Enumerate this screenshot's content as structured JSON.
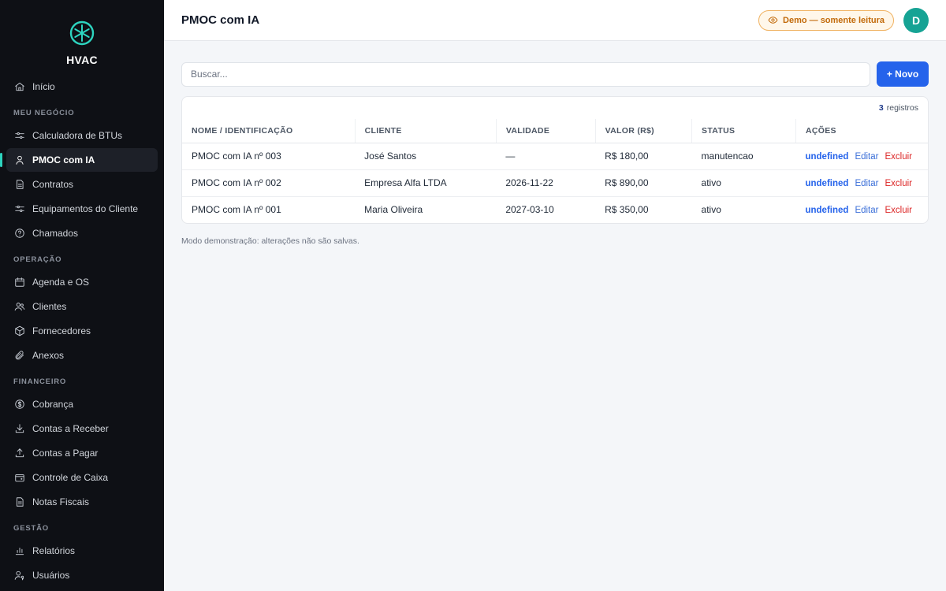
{
  "brand": {
    "name": "HVAC",
    "accent": "#2dd4bf"
  },
  "sidebar": {
    "top_items": [
      {
        "label": "Início",
        "icon": "home-icon"
      }
    ],
    "sections": [
      {
        "title": "MEU NEGÓCIO",
        "items": [
          {
            "label": "Calculadora de BTUs",
            "icon": "sliders-icon"
          },
          {
            "label": "PMOC com IA",
            "icon": "user-shield-icon",
            "active": true
          },
          {
            "label": "Contratos",
            "icon": "document-icon"
          },
          {
            "label": "Equipamentos do Cliente",
            "icon": "sliders-icon"
          },
          {
            "label": "Chamados",
            "icon": "help-circle-icon"
          }
        ]
      },
      {
        "title": "OPERAÇÃO",
        "items": [
          {
            "label": "Agenda e OS",
            "icon": "calendar-icon"
          },
          {
            "label": "Clientes",
            "icon": "users-icon"
          },
          {
            "label": "Fornecedores",
            "icon": "box-icon"
          },
          {
            "label": "Anexos",
            "icon": "paperclip-icon"
          }
        ]
      },
      {
        "title": "FINANCEIRO",
        "items": [
          {
            "label": "Cobrança",
            "icon": "dollar-circle-icon"
          },
          {
            "label": "Contas a Receber",
            "icon": "download-icon"
          },
          {
            "label": "Contas a Pagar",
            "icon": "upload-icon"
          },
          {
            "label": "Controle de Caixa",
            "icon": "wallet-icon"
          },
          {
            "label": "Notas Fiscais",
            "icon": "document-icon"
          }
        ]
      },
      {
        "title": "GESTÃO",
        "items": [
          {
            "label": "Relatórios",
            "icon": "bar-chart-icon"
          },
          {
            "label": "Usuários",
            "icon": "user-key-icon"
          }
        ]
      }
    ]
  },
  "header": {
    "title": "PMOC com IA",
    "demo_badge": "Demo — somente leitura",
    "avatar_initial": "D"
  },
  "toolbar": {
    "search_placeholder": "Buscar...",
    "new_label": "+ Novo"
  },
  "table": {
    "count": "3",
    "count_suffix": "registros",
    "columns": [
      "NOME / IDENTIFICAÇÃO",
      "CLIENTE",
      "VALIDADE",
      "VALOR (R$)",
      "STATUS",
      "AÇÕES"
    ],
    "rows": [
      {
        "name": "PMOC com IA nº 003",
        "client": "José Santos",
        "validity": "—",
        "value": "R$ 180,00",
        "status": "manutencao"
      },
      {
        "name": "PMOC com IA nº 002",
        "client": "Empresa Alfa LTDA",
        "validity": "2026-11-22",
        "value": "R$ 890,00",
        "status": "ativo"
      },
      {
        "name": "PMOC com IA nº 001",
        "client": "Maria Oliveira",
        "validity": "2027-03-10",
        "value": "R$ 350,00",
        "status": "ativo"
      }
    ],
    "actions": {
      "view": "undefined",
      "edit": "Editar",
      "delete": "Excluir"
    }
  },
  "note": "Modo demonstração: alterações não são salvas.",
  "colors": {
    "primary": "#2563eb",
    "danger": "#dc2626",
    "warning": "#c26a0a",
    "avatar": "#16a394",
    "sidebar_bg": "#0e1015"
  }
}
